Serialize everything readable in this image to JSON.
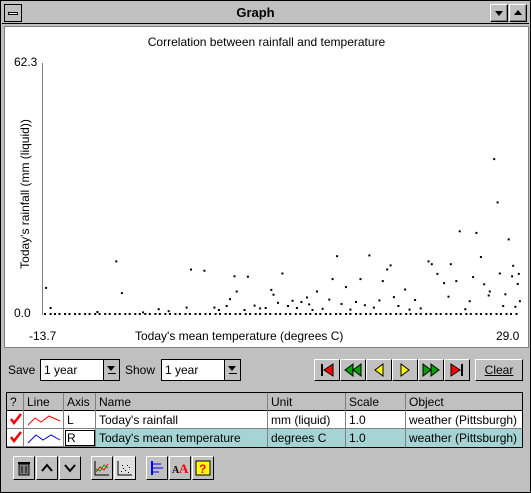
{
  "window": {
    "title": "Graph"
  },
  "chart_data": {
    "type": "scatter",
    "title": "Correlation between rainfall and temperature",
    "xlabel": "Today's mean temperature (degrees C)",
    "ylabel": "Today's rainfall (mm (liquid))",
    "xlim": [
      -13.7,
      29.0
    ],
    "ylim": [
      0.0,
      62.3
    ],
    "x_min_label": "-13.7",
    "x_max_label": "29.0",
    "y_min_label": "0.0",
    "y_max_label": "62.3",
    "points": [
      [
        -13.7,
        0
      ],
      [
        -13.2,
        0
      ],
      [
        -12.8,
        0
      ],
      [
        -12.4,
        0
      ],
      [
        -11.9,
        0
      ],
      [
        -11.5,
        0
      ],
      [
        -11.0,
        0
      ],
      [
        -10.6,
        0
      ],
      [
        -10.1,
        0
      ],
      [
        -9.7,
        0
      ],
      [
        -9.2,
        0
      ],
      [
        -8.8,
        0
      ],
      [
        -8.3,
        0
      ],
      [
        -7.9,
        0
      ],
      [
        -7.4,
        0
      ],
      [
        -7.0,
        0
      ],
      [
        -6.5,
        0
      ],
      [
        -6.1,
        0
      ],
      [
        -5.6,
        0
      ],
      [
        -5.2,
        0
      ],
      [
        -4.7,
        0
      ],
      [
        -4.3,
        0
      ],
      [
        -3.8,
        0
      ],
      [
        -3.4,
        0
      ],
      [
        -2.9,
        0
      ],
      [
        -2.5,
        0
      ],
      [
        -2.0,
        0
      ],
      [
        -1.6,
        0
      ],
      [
        -1.1,
        0
      ],
      [
        -0.7,
        0
      ],
      [
        -0.2,
        0
      ],
      [
        0.2,
        0
      ],
      [
        0.7,
        0
      ],
      [
        1.1,
        0
      ],
      [
        1.6,
        0
      ],
      [
        2.0,
        0
      ],
      [
        2.5,
        0
      ],
      [
        2.9,
        0
      ],
      [
        3.4,
        0
      ],
      [
        3.8,
        0
      ],
      [
        4.3,
        0
      ],
      [
        4.7,
        0
      ],
      [
        5.2,
        0
      ],
      [
        5.6,
        0
      ],
      [
        6.1,
        0
      ],
      [
        6.5,
        0
      ],
      [
        7.0,
        0
      ],
      [
        7.4,
        0
      ],
      [
        7.9,
        0
      ],
      [
        8.3,
        0
      ],
      [
        8.8,
        0
      ],
      [
        9.2,
        0
      ],
      [
        9.7,
        0
      ],
      [
        10.1,
        0
      ],
      [
        10.6,
        0
      ],
      [
        11.0,
        0
      ],
      [
        11.5,
        0
      ],
      [
        11.9,
        0
      ],
      [
        12.4,
        0
      ],
      [
        12.8,
        0
      ],
      [
        13.3,
        0
      ],
      [
        13.7,
        0
      ],
      [
        14.2,
        0
      ],
      [
        14.6,
        0
      ],
      [
        15.1,
        0
      ],
      [
        15.5,
        0
      ],
      [
        16.0,
        0
      ],
      [
        16.4,
        0
      ],
      [
        16.9,
        0
      ],
      [
        17.3,
        0
      ],
      [
        17.8,
        0
      ],
      [
        18.2,
        0
      ],
      [
        18.7,
        0
      ],
      [
        19.1,
        0
      ],
      [
        19.6,
        0
      ],
      [
        20.0,
        0
      ],
      [
        20.5,
        0
      ],
      [
        20.9,
        0
      ],
      [
        21.4,
        0
      ],
      [
        21.8,
        0
      ],
      [
        22.3,
        0
      ],
      [
        22.7,
        0
      ],
      [
        23.2,
        0
      ],
      [
        23.6,
        0
      ],
      [
        24.1,
        0
      ],
      [
        24.5,
        0
      ],
      [
        25.0,
        0
      ],
      [
        25.4,
        0
      ],
      [
        25.9,
        0
      ],
      [
        26.3,
        0
      ],
      [
        26.8,
        0
      ],
      [
        27.2,
        0
      ],
      [
        27.7,
        0
      ],
      [
        28.1,
        0
      ],
      [
        28.6,
        0
      ],
      [
        -13.6,
        6.5
      ],
      [
        -13.2,
        1.5
      ],
      [
        -9.0,
        0.5
      ],
      [
        -7.3,
        13.1
      ],
      [
        -6.8,
        5.2
      ],
      [
        -4.9,
        0.4
      ],
      [
        -3.5,
        1.2
      ],
      [
        -2.6,
        0.7
      ],
      [
        -1.0,
        1.6
      ],
      [
        -0.6,
        11.1
      ],
      [
        0.6,
        10.8
      ],
      [
        1.5,
        1.6
      ],
      [
        1.9,
        1.0
      ],
      [
        2.6,
        2.0
      ],
      [
        2.9,
        3.7
      ],
      [
        3.3,
        9.4
      ],
      [
        3.5,
        5.6
      ],
      [
        4.2,
        1.0
      ],
      [
        4.5,
        9.3
      ],
      [
        5.1,
        2.1
      ],
      [
        5.6,
        1.4
      ],
      [
        6.1,
        1.5
      ],
      [
        6.6,
        6.0
      ],
      [
        6.8,
        4.8
      ],
      [
        7.2,
        2.8
      ],
      [
        7.6,
        10.1
      ],
      [
        8.1,
        2.0
      ],
      [
        8.5,
        3.3
      ],
      [
        8.9,
        1.5
      ],
      [
        9.3,
        3.0
      ],
      [
        9.8,
        4.1
      ],
      [
        10.0,
        2.4
      ],
      [
        10.3,
        1.0
      ],
      [
        10.7,
        5.6
      ],
      [
        11.2,
        1.3
      ],
      [
        11.8,
        3.6
      ],
      [
        12.1,
        8.7
      ],
      [
        12.5,
        14.4
      ],
      [
        12.9,
        2.5
      ],
      [
        13.3,
        6.7
      ],
      [
        13.7,
        1.1
      ],
      [
        14.2,
        3.0
      ],
      [
        14.6,
        8.7
      ],
      [
        15.0,
        2.2
      ],
      [
        15.4,
        14.6
      ],
      [
        15.8,
        1.6
      ],
      [
        16.3,
        3.4
      ],
      [
        16.6,
        8.2
      ],
      [
        17.0,
        11.1
      ],
      [
        17.3,
        12.1
      ],
      [
        17.6,
        4.2
      ],
      [
        18.0,
        2.0
      ],
      [
        18.6,
        6.1
      ],
      [
        19.0,
        1.1
      ],
      [
        19.5,
        3.5
      ],
      [
        20.0,
        1.4
      ],
      [
        20.7,
        13.1
      ],
      [
        21.0,
        12.4
      ],
      [
        21.5,
        10.0
      ],
      [
        22.1,
        7.7
      ],
      [
        22.5,
        4.3
      ],
      [
        22.7,
        12.4
      ],
      [
        23.2,
        8.2
      ],
      [
        23.5,
        20.6
      ],
      [
        24.0,
        1.2
      ],
      [
        24.4,
        3.2
      ],
      [
        24.7,
        9.2
      ],
      [
        25.0,
        20.2
      ],
      [
        25.4,
        14.2
      ],
      [
        25.7,
        7.4
      ],
      [
        26.1,
        4.6
      ],
      [
        26.2,
        5.6
      ],
      [
        26.6,
        38.6
      ],
      [
        26.9,
        27.8
      ],
      [
        27.1,
        10.1
      ],
      [
        27.4,
        2.0
      ],
      [
        27.6,
        4.9
      ],
      [
        27.9,
        18.6
      ],
      [
        28.2,
        9.4
      ],
      [
        28.5,
        1.8
      ],
      [
        28.8,
        10.0
      ],
      [
        28.9,
        3.2
      ],
      [
        28.7,
        7.5
      ],
      [
        28.3,
        12.0
      ]
    ]
  },
  "controls": {
    "save_label": "Save",
    "save_value": "1 year",
    "show_label": "Show",
    "show_value": "1 year",
    "clear_label": "Clear"
  },
  "table": {
    "headers": [
      "?",
      "Line",
      "Axis",
      "Name",
      "Unit",
      "Scale",
      "Object"
    ],
    "rows": [
      {
        "axis": "L",
        "name": "Today's rainfall",
        "unit": "mm (liquid)",
        "scale": "1.0",
        "object": "weather (Pittsburgh)",
        "color": "#ff0000"
      },
      {
        "axis": "R",
        "name": "Today's mean temperature",
        "unit": "degrees C",
        "scale": "1.0",
        "object": "weather (Pittsburgh)",
        "color": "#0000ff"
      }
    ]
  },
  "colors": {
    "play_green": "#00a000",
    "stop_red": "#ff0000",
    "step_yellow": "#ffff00",
    "selection": "#a6d4d4"
  }
}
